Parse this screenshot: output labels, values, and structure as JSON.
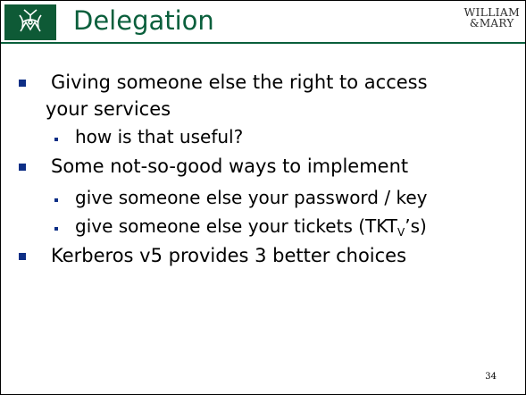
{
  "slide": {
    "title": "Delegation",
    "wordmark": {
      "line1": "WILLIAM",
      "line2": "&MARY"
    },
    "bullets": [
      {
        "level": 1,
        "text": "Giving someone else the right to access"
      },
      {
        "level": 1,
        "text": "your services"
      },
      {
        "level": 2,
        "text": "how is that useful?"
      },
      {
        "level": 1,
        "text": "Some not-so-good ways to implement"
      },
      {
        "level": 2,
        "text": "give someone else your password / key"
      },
      {
        "level": 2,
        "pre": "give someone else your tickets (TKT",
        "sub": "V",
        "post": "’s)"
      },
      {
        "level": 1,
        "text": "Kerberos v5 provides 3 better choices"
      }
    ],
    "page_number": "34"
  },
  "colors": {
    "title": "#0a5f3c",
    "bullet": "#0e2f86",
    "logo_bg": "#0e5a36"
  },
  "icons": {
    "logo": "cypher-crest-icon"
  }
}
